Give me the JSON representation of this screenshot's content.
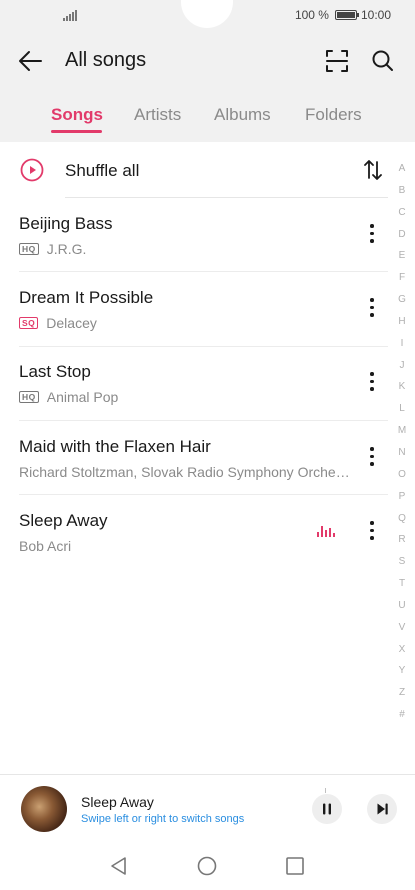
{
  "status": {
    "battery_text": "100 %",
    "time": "10:00"
  },
  "header": {
    "title": "All songs",
    "back_icon": "arrow-left-icon",
    "scan_icon": "scan-icon",
    "search_icon": "search-icon"
  },
  "tabs": [
    {
      "label": "Songs",
      "active": true
    },
    {
      "label": "Artists",
      "active": false
    },
    {
      "label": "Albums",
      "active": false
    },
    {
      "label": "Folders",
      "active": false
    }
  ],
  "shuffle": {
    "label": "Shuffle all",
    "icon": "play-circle-icon",
    "sort_icon": "sort-icon"
  },
  "songs": [
    {
      "title": "Beijing Bass",
      "badge": "HQ",
      "artist": "J.R.G.",
      "playing": false
    },
    {
      "title": "Dream It Possible",
      "badge": "SQ",
      "artist": "Delacey",
      "playing": false
    },
    {
      "title": "Last Stop",
      "badge": "HQ",
      "artist": "Animal Pop",
      "playing": false
    },
    {
      "title": "Maid with the Flaxen Hair",
      "badge": "",
      "artist": "Richard Stoltzman, Slovak Radio Symphony Orche…",
      "playing": false
    },
    {
      "title": "Sleep Away",
      "badge": "",
      "artist": "Bob Acri",
      "playing": true
    }
  ],
  "alphabet": [
    "A",
    "B",
    "C",
    "D",
    "E",
    "F",
    "G",
    "H",
    "I",
    "J",
    "K",
    "L",
    "M",
    "N",
    "O",
    "P",
    "Q",
    "R",
    "S",
    "T",
    "U",
    "V",
    "X",
    "Y",
    "Z",
    "#"
  ],
  "now_playing": {
    "title": "Sleep Away",
    "hint": "Swipe left or right to switch songs",
    "pause_icon": "pause-icon",
    "next_icon": "skip-next-icon"
  },
  "colors": {
    "accent": "#e23a6a",
    "hint_blue": "#2a8ee0",
    "header_bg": "#f1f1f1"
  }
}
